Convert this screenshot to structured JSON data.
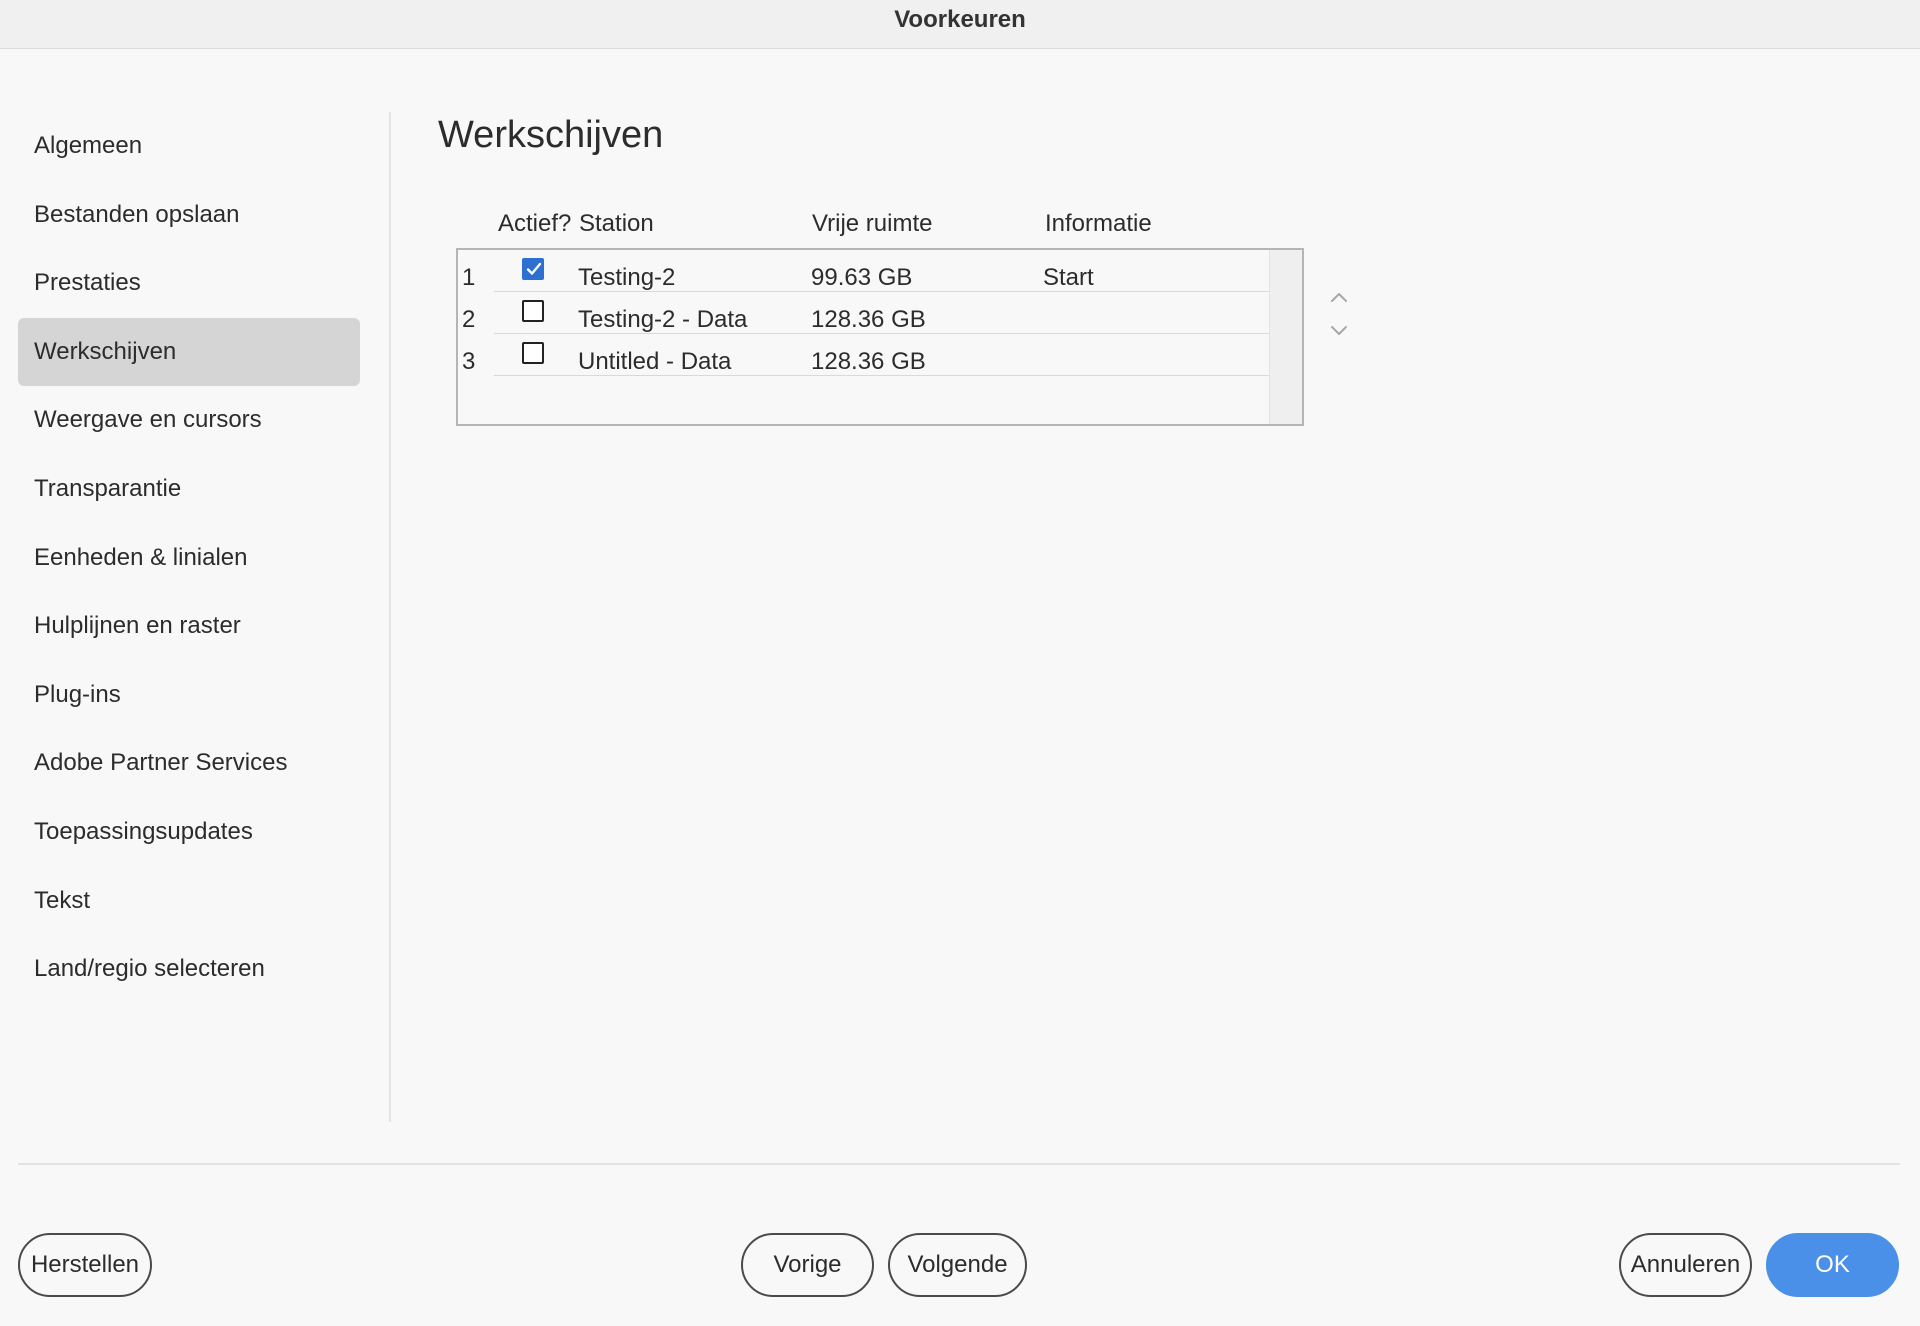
{
  "window": {
    "title": "Voorkeuren"
  },
  "sidebar": {
    "items": [
      {
        "label": "Algemeen"
      },
      {
        "label": "Bestanden opslaan"
      },
      {
        "label": "Prestaties"
      },
      {
        "label": "Werkschijven",
        "selected": true
      },
      {
        "label": "Weergave en cursors"
      },
      {
        "label": "Transparantie"
      },
      {
        "label": "Eenheden & linialen"
      },
      {
        "label": "Hulplijnen en raster"
      },
      {
        "label": "Plug-ins"
      },
      {
        "label": "Adobe Partner Services"
      },
      {
        "label": "Toepassingsupdates"
      },
      {
        "label": "Tekst"
      },
      {
        "label": "Land/regio selecteren"
      }
    ]
  },
  "main": {
    "title": "Werkschijven",
    "table": {
      "headers": {
        "active": "Actief?",
        "station": "Station",
        "free_space": "Vrije ruimte",
        "info": "Informatie"
      },
      "rows": [
        {
          "index": "1",
          "active": true,
          "station": "Testing-2",
          "free_space": "99.63 GB",
          "info": "Start"
        },
        {
          "index": "2",
          "active": false,
          "station": "Testing-2 - Data",
          "free_space": "128.36 GB",
          "info": ""
        },
        {
          "index": "3",
          "active": false,
          "station": "Untitled - Data",
          "free_space": "128.36 GB",
          "info": ""
        }
      ]
    }
  },
  "footer": {
    "reset_label": "Herstellen",
    "prev_label": "Vorige",
    "next_label": "Volgende",
    "cancel_label": "Annuleren",
    "ok_label": "OK"
  },
  "colors": {
    "accent": "#4a90e8",
    "checkbox_checked": "#2e6fd2",
    "selected_item_bg": "#d5d5d5",
    "background": "#f8f8f8"
  },
  "icons": {
    "move_up": "chevron-up-icon",
    "move_down": "chevron-down-icon",
    "checked": "check-icon"
  }
}
